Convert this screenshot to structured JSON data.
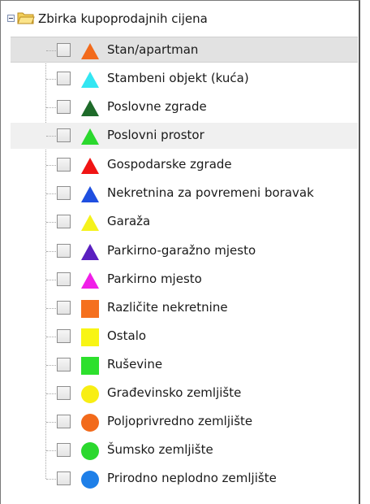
{
  "tree": {
    "root_label": "Zbirka kupoprodajnih cijena",
    "items": [
      {
        "label": "Stan/apartman",
        "shape": "triangle",
        "color": "#F26A1B",
        "icon": "triangle-orange-icon"
      },
      {
        "label": "Stambeni objekt (kuća)",
        "shape": "triangle",
        "color": "#33E6F2",
        "icon": "triangle-cyan-icon"
      },
      {
        "label": "Poslovne zgrade",
        "shape": "triangle",
        "color": "#1E6B2A",
        "icon": "triangle-dark-green-icon"
      },
      {
        "label": "Poslovni prostor",
        "shape": "triangle",
        "color": "#2BD82E",
        "icon": "triangle-green-icon"
      },
      {
        "label": "Gospodarske zgrade",
        "shape": "triangle",
        "color": "#F01414",
        "icon": "triangle-red-icon"
      },
      {
        "label": "Nekretnina za povremeni boravak",
        "shape": "triangle",
        "color": "#1F4FE0",
        "icon": "triangle-blue-icon"
      },
      {
        "label": "Garaža",
        "shape": "triangle",
        "color": "#F5F21B",
        "icon": "triangle-yellow-icon"
      },
      {
        "label": "Parkirno-garažno mjesto",
        "shape": "triangle",
        "color": "#5A1FC0",
        "icon": "triangle-purple-icon"
      },
      {
        "label": "Parkirno mjesto",
        "shape": "triangle",
        "color": "#F01EE8",
        "icon": "triangle-magenta-icon"
      },
      {
        "label": "Različite nekretnine",
        "shape": "square",
        "color": "#F5701E",
        "icon": "square-orange-icon"
      },
      {
        "label": "Ostalo",
        "shape": "square",
        "color": "#F8F514",
        "icon": "square-yellow-icon"
      },
      {
        "label": "Ruševine",
        "shape": "square",
        "color": "#2DE02D",
        "icon": "square-green-icon"
      },
      {
        "label": "Građevinsko zemljište",
        "shape": "circle",
        "color": "#F8EE14",
        "icon": "circle-yellow-icon"
      },
      {
        "label": "Poljoprivredno zemljište",
        "shape": "circle",
        "color": "#F26A1B",
        "icon": "circle-orange-icon"
      },
      {
        "label": "Šumsko zemljište",
        "shape": "circle",
        "color": "#2BD82E",
        "icon": "circle-green-icon"
      },
      {
        "label": "Prirodno neplodno zemljište",
        "shape": "circle",
        "color": "#1E7FE8",
        "icon": "circle-blue-icon"
      }
    ]
  },
  "state": {
    "selected_index": 0,
    "highlighted_index": 3,
    "checked": [
      false,
      false,
      false,
      false,
      false,
      false,
      false,
      false,
      false,
      false,
      false,
      false,
      false,
      false,
      false,
      false
    ]
  }
}
